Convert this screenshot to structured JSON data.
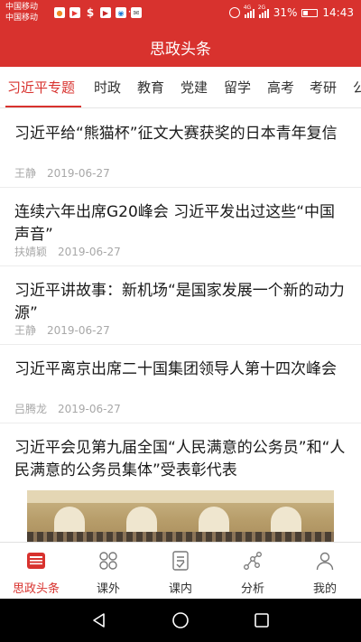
{
  "status_bar": {
    "carrier_1": "中国移动",
    "carrier_2": "中国移动",
    "icons": [
      "notification-app-icon",
      "video-app-icon",
      "dollar-app-icon",
      "play-app-icon",
      "wifi-app-icon",
      "message-app-icon"
    ],
    "dots": "···",
    "signal_1_label": "4G",
    "signal_2_label": "2G",
    "battery": "31%",
    "time": "14:43"
  },
  "app_title": "思政头条",
  "tabs": [
    {
      "label": "习近平专题",
      "active": true
    },
    {
      "label": "时政"
    },
    {
      "label": "教育"
    },
    {
      "label": "党建"
    },
    {
      "label": "留学"
    },
    {
      "label": "高考"
    },
    {
      "label": "考研"
    },
    {
      "label": "公"
    }
  ],
  "articles": [
    {
      "title": "习近平给“熊猫杯”征文大赛获奖的日本青年复信",
      "author": "王静",
      "date": "2019-06-27"
    },
    {
      "title": "连续六年出席G20峰会 习近平发出过这些“中国声音”",
      "author": "扶婧颖",
      "date": "2019-06-27"
    },
    {
      "title": "习近平讲故事：新机场“是国家发展一个新的动力源”",
      "author": "王静",
      "date": "2019-06-27"
    },
    {
      "title": "习近平离京出席二十国集团领导人第十四次峰会",
      "author": "吕腾龙",
      "date": "2019-06-27"
    },
    {
      "title": "习近平会见第九届全国“人民满意的公务员”和“人民满意的公务员集体”受表彰代表",
      "author": "",
      "date": ""
    }
  ],
  "bottom_nav": [
    {
      "label": "思政头条",
      "icon": "newspaper-icon",
      "active": true
    },
    {
      "label": "课外",
      "icon": "clover-icon"
    },
    {
      "label": "课内",
      "icon": "notebook-icon"
    },
    {
      "label": "分析",
      "icon": "network-icon"
    },
    {
      "label": "我的",
      "icon": "person-icon"
    }
  ],
  "colors": {
    "brand_red": "#d8322e",
    "text_primary": "#1a1a1a",
    "text_meta": "#a8a8a8"
  }
}
